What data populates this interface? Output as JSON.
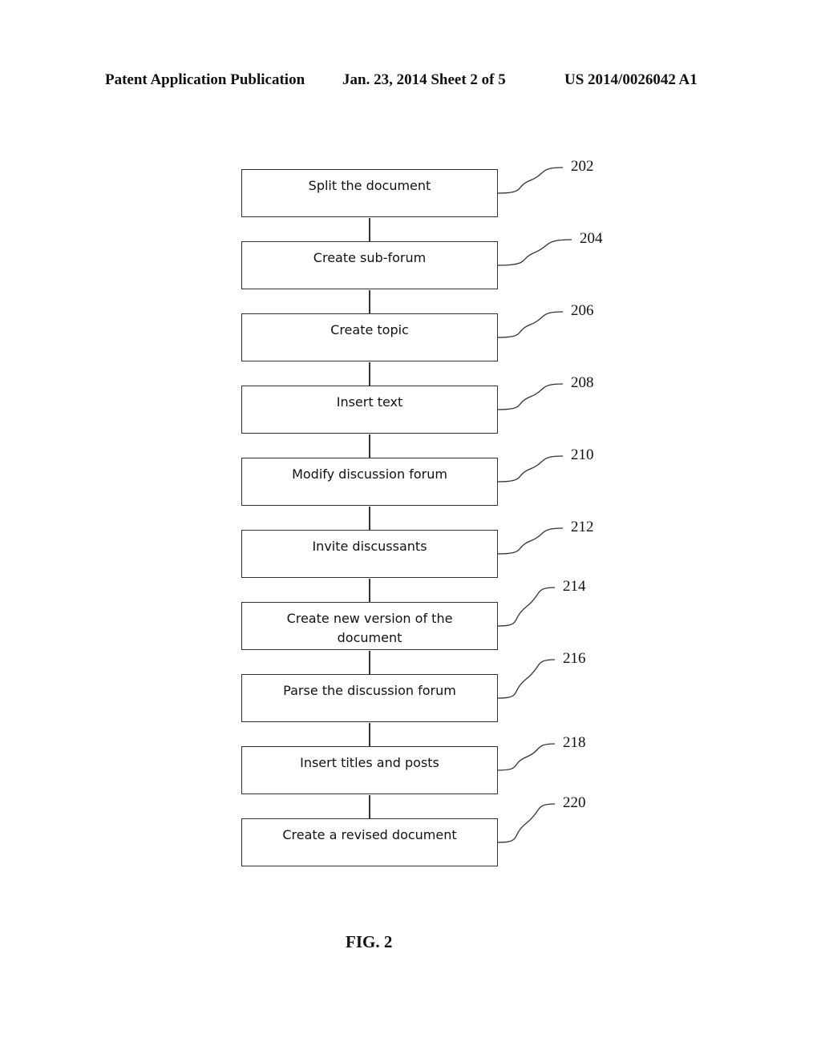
{
  "header": {
    "publication_type": "Patent Application Publication",
    "date_sheet": "Jan. 23, 2014  Sheet 2 of 5",
    "publication_number": "US 2014/0026042 A1"
  },
  "flowchart": {
    "steps": [
      {
        "ref": "202",
        "label": "Split the document"
      },
      {
        "ref": "204",
        "label": "Create sub-forum"
      },
      {
        "ref": "206",
        "label": "Create topic"
      },
      {
        "ref": "208",
        "label": "Insert text"
      },
      {
        "ref": "210",
        "label": "Modify discussion forum"
      },
      {
        "ref": "212",
        "label": "Invite discussants"
      },
      {
        "ref": "214",
        "label": "Create new version of the document"
      },
      {
        "ref": "216",
        "label": "Parse the discussion forum"
      },
      {
        "ref": "218",
        "label": "Insert titles and posts"
      },
      {
        "ref": "220",
        "label": "Create a revised document"
      }
    ]
  },
  "figure_label": "FIG. 2"
}
